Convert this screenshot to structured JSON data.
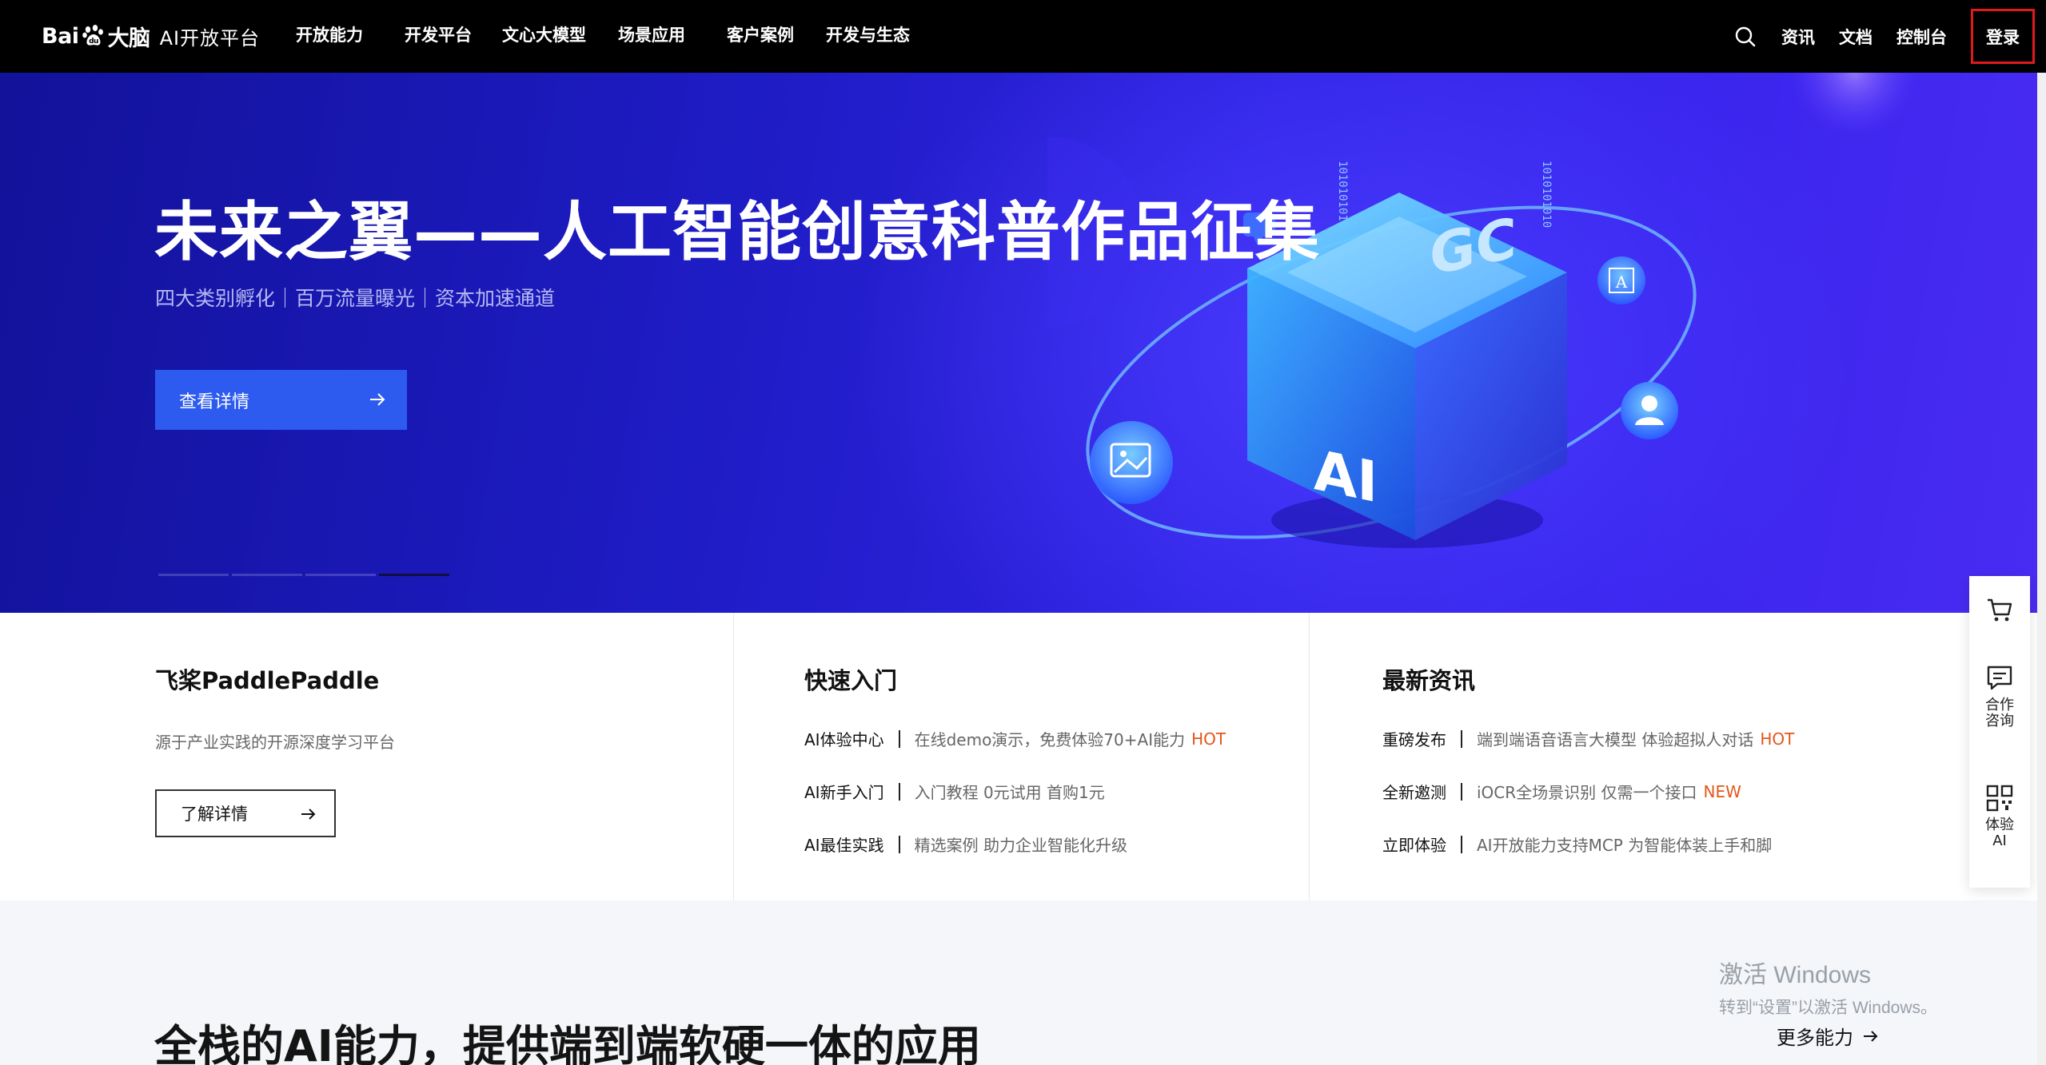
{
  "nav": {
    "logo_text": "AI开放平台",
    "logo_mark": "Bai",
    "logo_mark2": "大脑",
    "items": [
      "开放能力",
      "开发平台",
      "文心大模型",
      "场景应用",
      "客户案例",
      "开发与生态"
    ],
    "right": [
      "资讯",
      "文档",
      "控制台"
    ],
    "login": "登录",
    "search_icon": "search-icon"
  },
  "hero": {
    "title": "未来之翼——人工智能创意科普作品征集",
    "subtitle": "四大类别孵化｜百万流量曝光｜资本加速通道",
    "button": "查看详情",
    "art_text_ai": "AI",
    "art_text_gc": "GC",
    "art_badge": "A",
    "slides_total": 4,
    "active_slide": 4
  },
  "cards": {
    "paddle": {
      "title": "飞桨PaddlePaddle",
      "desc": "源于产业实践的开源深度学习平台",
      "button": "了解详情"
    },
    "quickstart": {
      "title": "快速入门",
      "rows": [
        {
          "k": "AI体验中心",
          "v": "在线demo演示，免费体验70+AI能力",
          "tag": "HOT"
        },
        {
          "k": "AI新手入门",
          "v": "入门教程 0元试用 首购1元",
          "tag": ""
        },
        {
          "k": "AI最佳实践",
          "v": "精选案例 助力企业智能化升级",
          "tag": ""
        }
      ]
    },
    "news": {
      "title": "最新资讯",
      "rows": [
        {
          "k": "重磅发布",
          "v": "端到端语音语言大模型 体验超拟人对话",
          "tag": "HOT"
        },
        {
          "k": "全新邀测",
          "v": "iOCR全场景识别 仅需一个接口",
          "tag": "NEW"
        },
        {
          "k": "立即体验",
          "v": "AI开放能力支持MCP 为智能体装上手和脚",
          "tag": ""
        }
      ]
    }
  },
  "lower": {
    "title": "全栈的AI能力，提供端到端软硬一体的应用",
    "more": "更多能力"
  },
  "watermark": {
    "line1": "激活 Windows",
    "line2": "转到“设置”以激活 Windows。"
  },
  "float_panel": {
    "items": [
      {
        "icon": "cart-icon",
        "label": ""
      },
      {
        "icon": "chat-icon",
        "label": "合作咨询"
      },
      {
        "icon": "qrcode-icon",
        "label": "体验AI"
      }
    ]
  },
  "colors": {
    "accent_red": "#e0191c",
    "hero_button": "#2d5bf0",
    "tag_orange": "#e4561c"
  }
}
